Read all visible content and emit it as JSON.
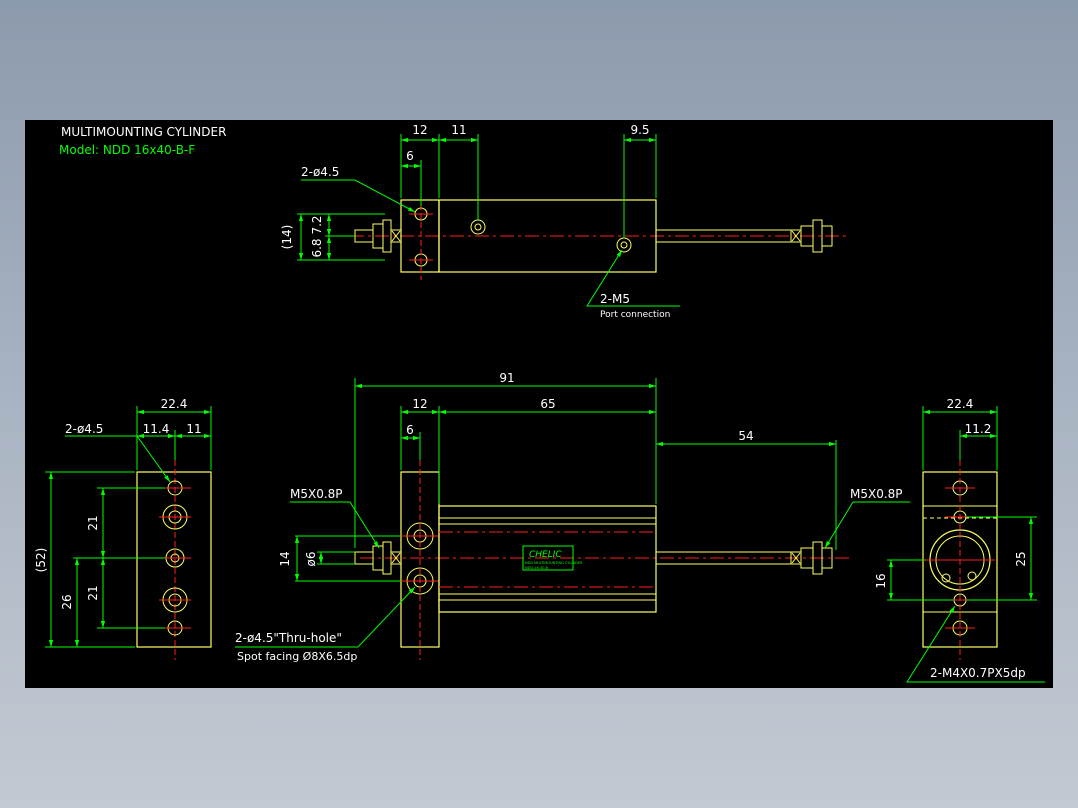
{
  "header": {
    "title": "MULTIMOUNTING CYLINDER",
    "model": "Model: NDD 16x40-B-F"
  },
  "colors": {
    "outline": "#ffff66",
    "dimension": "#00ff00",
    "center": "#ff2020",
    "text": "#ffffff",
    "background": "#000000"
  },
  "top_view": {
    "dims": {
      "d12": "12",
      "d11": "11",
      "d9_5": "9.5",
      "d6": "6",
      "d14": "(14)",
      "d7_2": "7.2",
      "d6_8": "6.8"
    },
    "callouts": {
      "holes": "2-ø4.5",
      "port": "2-M5",
      "port_note": "Port connection"
    }
  },
  "front_view": {
    "dims": {
      "d91": "91",
      "d12": "12",
      "d65": "65",
      "d54": "54",
      "d6": "6",
      "d14": "14",
      "phi6": "ø6"
    },
    "callouts": {
      "left_thread": "M5X0.8P",
      "right_thread": "M5X0.8P",
      "thru_hole": "2-ø4.5\"Thru-hole\"",
      "spot_facing": "Spot facing  Ø8X6.5dp"
    },
    "label": {
      "brand": "CHELIC",
      "line1": "NDD MULTIMOUNTING CYLINDER",
      "line2": "NDD-16-40-B"
    }
  },
  "left_view": {
    "dims": {
      "d22_4": "22.4",
      "d11_4": "11.4",
      "d11": "11",
      "d52": "(52)",
      "d26": "26",
      "d21a": "21",
      "d21b": "21"
    },
    "callouts": {
      "holes": "2-ø4.5"
    }
  },
  "right_view": {
    "dims": {
      "d22_4": "22.4",
      "d11_2": "11.2",
      "d25": "25",
      "d16": "16"
    },
    "callouts": {
      "tapped": "2-M4X0.7PX5dp"
    }
  }
}
